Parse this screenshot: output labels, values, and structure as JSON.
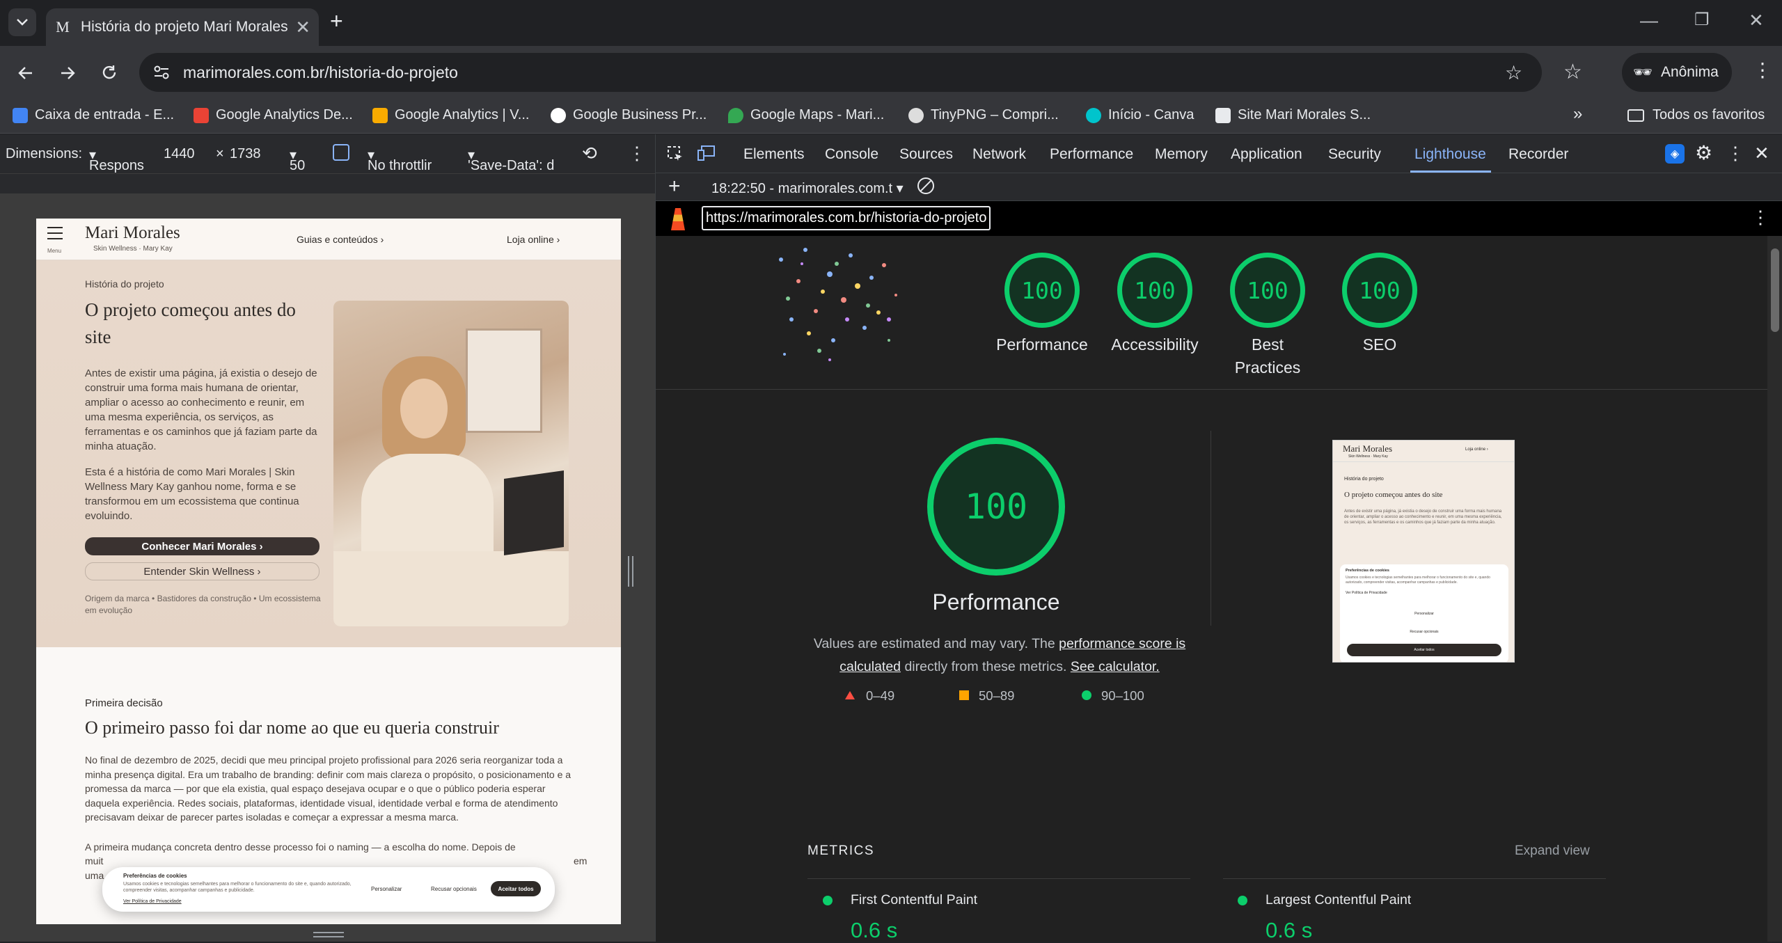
{
  "browser": {
    "tab_title": "História do projeto Mari Morales",
    "tab_favicon": "M",
    "new_tab_symbol": "+",
    "url": "marimorales.com.br/historia-do-projeto",
    "profile_label": "Anônima"
  },
  "bookmarks": [
    {
      "label": "Caixa de entrada - E...",
      "icon": "gmail-icon",
      "color": "#4285f4"
    },
    {
      "label": "Google Analytics De...",
      "icon": "analytics-doc-icon",
      "color": "#ea4335"
    },
    {
      "label": "Google Analytics | V...",
      "icon": "analytics-icon",
      "color": "#f9ab00"
    },
    {
      "label": "Google Business Pr...",
      "icon": "google-icon",
      "color": "#ffffff"
    },
    {
      "label": "Google Maps - Mari...",
      "icon": "maps-icon",
      "color": "#34a853"
    },
    {
      "label": "TinyPNG – Compri...",
      "icon": "panda-icon",
      "color": "#dddddd"
    },
    {
      "label": "Início - Canva",
      "icon": "canva-icon",
      "color": "#00c4cc"
    },
    {
      "label": "Site Mari Morales S...",
      "icon": "site-icon",
      "color": "#e8eaed"
    }
  ],
  "bookmarks_more": "»",
  "bookmarks_all": "Todos os favoritos",
  "device_toolbar": {
    "dimensions_label": "Dimensions:",
    "dimensions_mode": "Respons",
    "width": "1440",
    "times": "×",
    "height": "1738",
    "zoom": "50",
    "throttling": "No throttlir",
    "save_data": "'Save-Data': d"
  },
  "site": {
    "logo": "Mari Morales",
    "logo_sub": "Skin Wellness · Mary Kay",
    "menu_label": "Menu",
    "nav_guides": "Guias e conteúdos ›",
    "nav_store": "Loja online ›",
    "hero_eyebrow": "História do projeto",
    "hero_title": "O projeto começou antes do site",
    "hero_p1": "Antes de existir uma página, já existia o desejo de construir uma forma mais humana de orientar, ampliar o acesso ao conhecimento e reunir, em uma mesma experiência, os serviços, as ferramentas e os caminhos que já faziam parte da minha atuação.",
    "hero_p2": "Esta é a história de como Mari Morales | Skin Wellness Mary Kay ganhou nome, forma e se transformou em um ecossistema que continua evoluindo.",
    "btn_primary": "Conhecer Mari Morales ›",
    "btn_secondary": "Entender Skin Wellness ›",
    "hero_tags": "Origem da marca • Bastidores da construção • Um ecossistema em evolução",
    "sec2_eyebrow": "Primeira decisão",
    "sec2_title": "O primeiro passo foi dar nome ao que eu queria construir",
    "sec2_p1": "No final de dezembro de 2025, decidi que meu principal projeto profissional para 2026 seria reorganizar toda a minha presença digital. Era um trabalho de branding: definir com mais clareza o propósito, o posicionamento e a promessa da marca — por que ela existia, qual espaço desejava ocupar e o que o público poderia esperar daquela experiência. Redes sociais, plataformas, identidade visual, identidade verbal e forma de atendimento precisavam deixar de parecer partes isoladas e começar a expressar a mesma marca.",
    "sec2_p2_start": "A primeira mudança concreta dentro desse processo foi o naming — a escolha do nome. Depois de",
    "sec2_p2_left_a": "muit",
    "sec2_p2_left_b": "uma",
    "sec2_p2_right": "em",
    "cookie_title": "Preferências de cookies",
    "cookie_text": "Usamos cookies e tecnologias semelhantes para melhorar o funcionamento do site e, quando autorizado, compreender visitas, acompanhar campanhas e publicidade.",
    "cookie_link": "Ver Política de Privacidade",
    "cookie_customize": "Personalizar",
    "cookie_reject": "Recusar opcionais",
    "cookie_accept": "Aceitar todos"
  },
  "devtools": {
    "tabs": [
      "Elements",
      "Console",
      "Sources",
      "Network",
      "Performance",
      "Memory",
      "Application",
      "Security",
      "Lighthouse",
      "Recorder"
    ],
    "active_tab": "Lighthouse",
    "report_time": "18:22:50 - marimorales.com.t",
    "report_url": "https://marimorales.com.br/historia-do-projeto"
  },
  "lighthouse": {
    "scores": [
      {
        "value": "100",
        "label": "Performance"
      },
      {
        "value": "100",
        "label": "Accessibility"
      },
      {
        "value": "100",
        "label": "Best Practices"
      },
      {
        "value": "100",
        "label": "SEO"
      }
    ],
    "main_score": "100",
    "main_label": "Performance",
    "note_prefix": "Values are estimated and may vary. The ",
    "note_link1": "performance score is calculated",
    "note_mid": " directly from these metrics. ",
    "note_link2": "See calculator.",
    "legend": [
      {
        "range": "0–49",
        "color": "#ff4e42"
      },
      {
        "range": "50–89",
        "color": "#ffa400"
      },
      {
        "range": "90–100",
        "color": "#0cce6b"
      }
    ],
    "metrics_title": "METRICS",
    "expand_view": "Expand view",
    "metrics": [
      {
        "name": "First Contentful Paint",
        "value": "0.6 s"
      },
      {
        "name": "Largest Contentful Paint",
        "value": "0.6 s"
      }
    ],
    "thumb": {
      "logo": "Mari Morales",
      "logo_sub": "Skin Wellness · Mary Kay",
      "nav_store": "Loja online ›",
      "eyebrow": "História do projeto",
      "title": "O projeto começou antes do site",
      "body": "Antes de existir uma página, já existia o desejo de construir uma forma mais humana de orientar, ampliar o acesso ao conhecimento e reunir, em uma mesma experiência, os serviços, as ferramentas e os caminhos que já faziam parte da minha atuação.",
      "cookie_title": "Preferências de cookies",
      "cookie_text": "Usamos cookies e tecnologias semelhantes para melhorar o funcionamento do site e, quando autorizado, compreender visitas, acompanhar campanhas e publicidade.",
      "cookie_link": "Ver Política de Privacidade",
      "customize": "Personalizar",
      "reject": "Recusar opcionais",
      "accept": "Aceitar todos"
    }
  }
}
